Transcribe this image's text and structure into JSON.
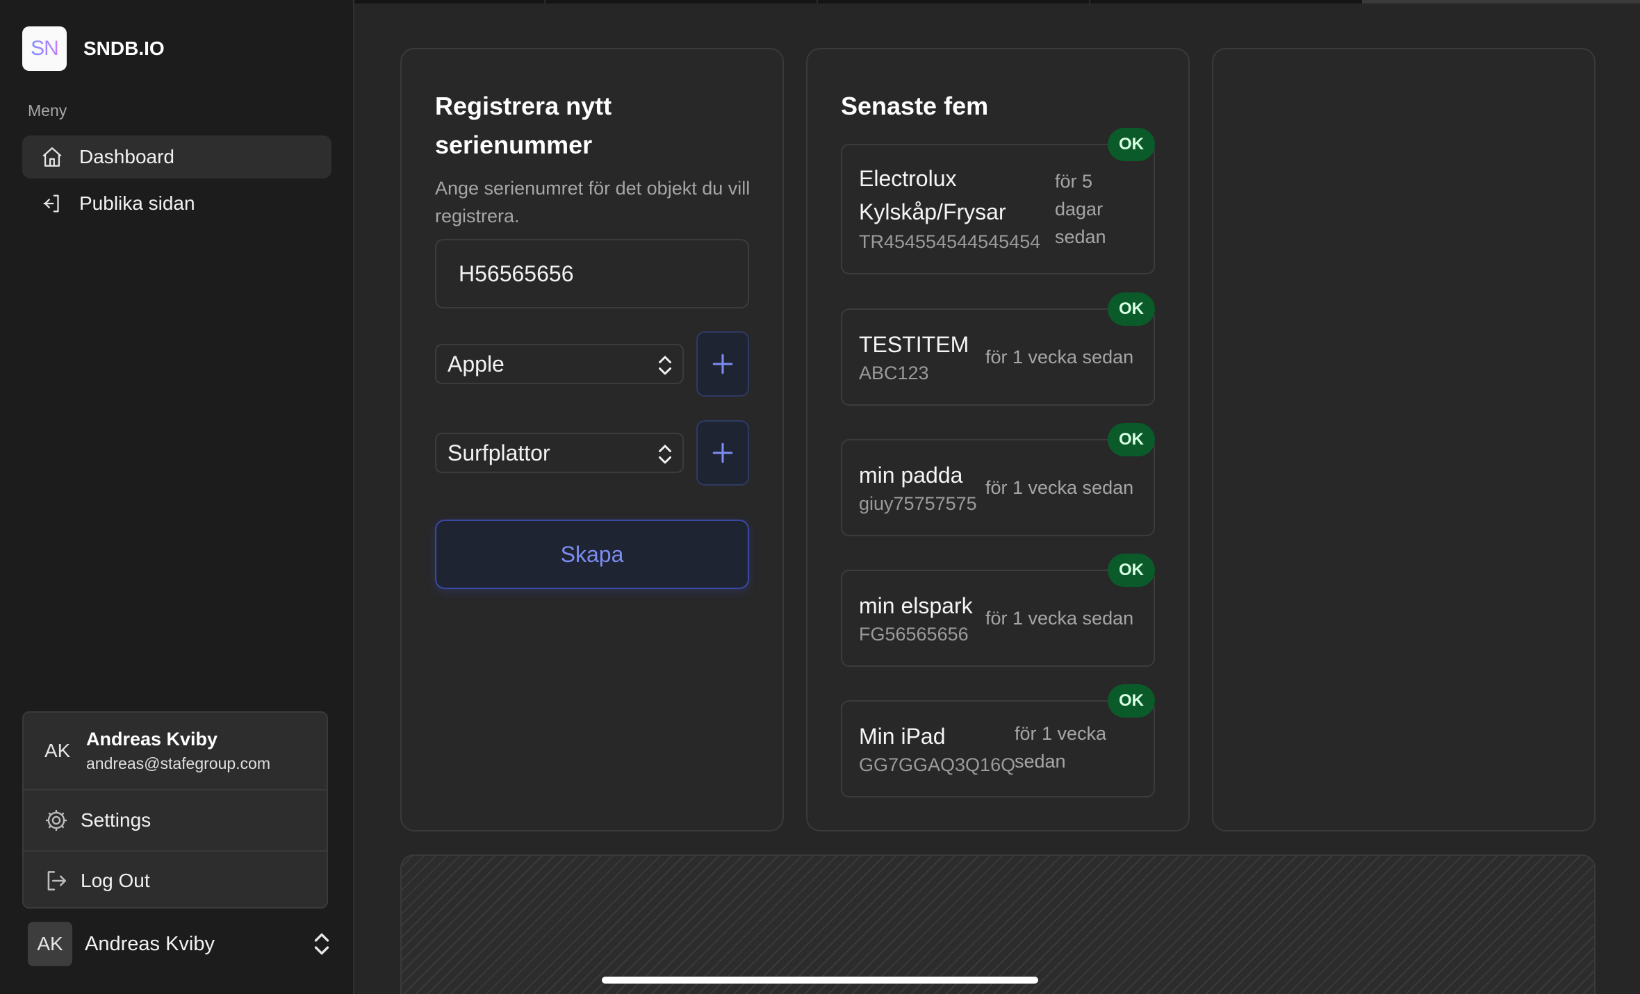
{
  "brand": {
    "logo_text": "SN",
    "name": "SNDB.IO"
  },
  "sidebar": {
    "menu_label": "Meny",
    "items": [
      {
        "label": "Dashboard",
        "icon": "home-icon",
        "active": true
      },
      {
        "label": "Publika sidan",
        "icon": "sign-in-icon",
        "active": false
      }
    ]
  },
  "user_menu": {
    "initials": "AK",
    "name": "Andreas Kviby",
    "email": "andreas@stafegroup.com",
    "settings_label": "Settings",
    "logout_label": "Log Out"
  },
  "user_switcher": {
    "initials": "AK",
    "name": "Andreas Kviby"
  },
  "register_card": {
    "title": "Registrera nytt serienummer",
    "description": "Ange serienumret för det objekt du vill registrera.",
    "serial_value": "H56565656",
    "brand_select": "Apple",
    "category_select": "Surfplattor",
    "create_label": "Skapa"
  },
  "recent_card": {
    "title": "Senaste fem",
    "items": [
      {
        "name": "Electrolux Kylskåp/Frysar",
        "serial": "TR454554544545454",
        "time": "för 5 dagar sedan",
        "status": "OK"
      },
      {
        "name": "TESTITEM",
        "serial": "ABC123",
        "time": "för 1 vecka sedan",
        "status": "OK"
      },
      {
        "name": "min padda",
        "serial": "giuy75757575",
        "time": "för 1 vecka sedan",
        "status": "OK"
      },
      {
        "name": "min elspark",
        "serial": "FG56565656",
        "time": "för 1 vecka sedan",
        "status": "OK"
      },
      {
        "name": "Min iPad",
        "serial": "GG7GGAQ3Q16Q",
        "time": "för 1 vecka sedan",
        "status": "OK"
      }
    ]
  },
  "colors": {
    "accent": "#7c8cf0",
    "badge_ok": "#0b5a2a",
    "background": "#262626",
    "sidebar": "#1c1c1c"
  }
}
